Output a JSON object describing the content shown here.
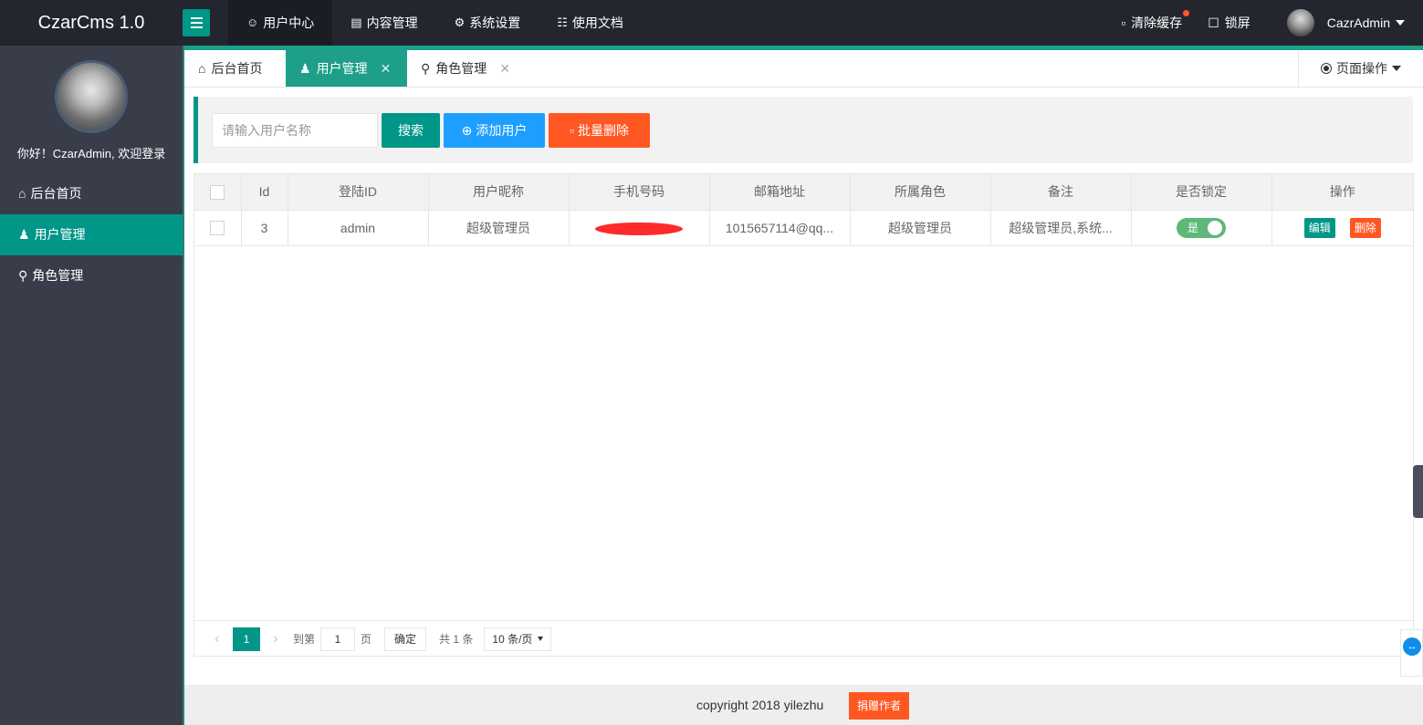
{
  "app": {
    "title": "CzarCms 1.0"
  },
  "topnav": [
    {
      "label": "用户中心",
      "icon": "users-icon"
    },
    {
      "label": "内容管理",
      "icon": "document-icon"
    },
    {
      "label": "系统设置",
      "icon": "gear-icon"
    },
    {
      "label": "使用文档",
      "icon": "book-icon"
    }
  ],
  "topright": {
    "clear_cache": "清除缓存",
    "lock": "锁屏",
    "user": "CazrAdmin"
  },
  "sidebar": {
    "welcome": "你好！CzarAdmin, 欢迎登录",
    "items": [
      {
        "label": "后台首页",
        "icon": "home-icon"
      },
      {
        "label": "用户管理",
        "icon": "user-icon"
      },
      {
        "label": "角色管理",
        "icon": "role-icon"
      }
    ]
  },
  "tabs": [
    {
      "label": "后台首页"
    },
    {
      "label": "用户管理"
    },
    {
      "label": "角色管理"
    }
  ],
  "page_op": "页面操作",
  "toolbar": {
    "search_placeholder": "请输入用户名称",
    "search_label": "搜索",
    "add_label": "添加用户",
    "delete_label": "批量删除"
  },
  "table": {
    "headers": [
      "Id",
      "登陆ID",
      "用户昵称",
      "手机号码",
      "邮箱地址",
      "所属角色",
      "备注",
      "是否锁定",
      "操作"
    ],
    "rows": [
      {
        "id": "3",
        "login_id": "admin",
        "nickname": "超级管理员",
        "phone": "",
        "email": "1015657114@qq...",
        "role": "超级管理员",
        "remark": "超级管理员,系统...",
        "locked_label": "是",
        "edit_label": "编辑",
        "delete_label": "删除"
      }
    ]
  },
  "pager": {
    "current": "1",
    "goto_label": "到第",
    "page_input": "1",
    "page_unit": "页",
    "confirm": "确定",
    "total": "共 1 条",
    "per_page": "10 条/页"
  },
  "footer": {
    "copyright": "copyright 2018 yilezhu",
    "donate": "捐赠作者"
  },
  "colors": {
    "accent": "#009688",
    "blue": "#1e9fff",
    "danger": "#ff5722",
    "header": "#23262e",
    "sidebar": "#393d49"
  }
}
